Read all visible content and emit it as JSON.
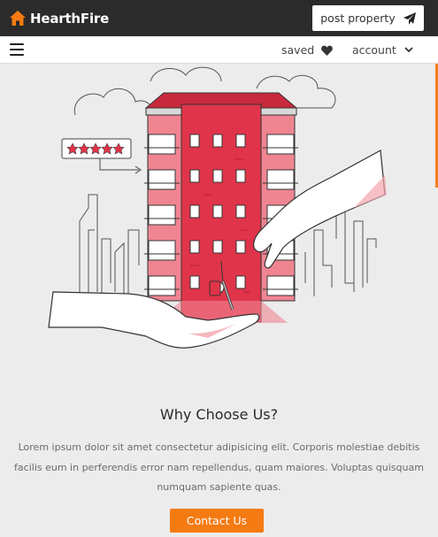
{
  "header": {
    "brand_name": "HearthFire",
    "brand_icon": "home-icon",
    "post_property_label": "post property",
    "post_icon": "paper-plane-icon"
  },
  "nav": {
    "menu_icon": "hamburger-menu-icon",
    "saved_label": "saved",
    "saved_icon": "heart-icon",
    "account_label": "account",
    "account_icon": "chevron-down-icon"
  },
  "hero": {
    "illustration": "apartment-building-key-handover-illustration",
    "rating_stars": 5
  },
  "content": {
    "heading": "Why Choose Us?",
    "paragraph": "Lorem ipsum dolor sit amet consectetur adipisicing elit. Corporis molestiae debitis facilis eum in perferendis error nam repellendus, quam maiores. Voluptas quisquam numquam sapiente quas.",
    "cta_label": "Contact Us"
  },
  "colors": {
    "topbar_bg": "#2b2b2b",
    "accent": "#f47b12",
    "building_red": "#e0344a",
    "page_bg": "#ececec"
  }
}
